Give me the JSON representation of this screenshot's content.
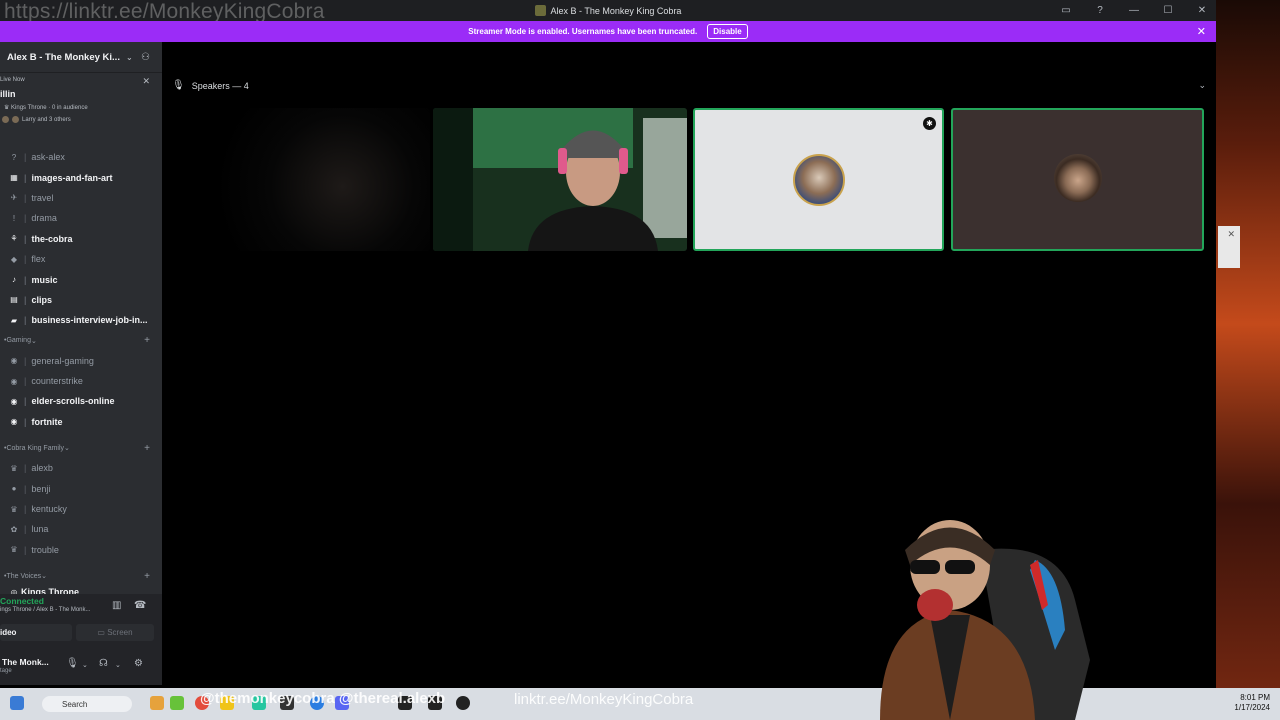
{
  "window": {
    "overlay_url": "https://linktr.ee/MonkeyKingCobra",
    "title": "Alex B - The Monkey King Cobra",
    "controls": [
      "▭",
      "?",
      "—",
      "☐",
      "✕"
    ]
  },
  "banner": {
    "message": "Streamer Mode is enabled. Usernames have been truncated.",
    "disable_label": "Disable",
    "close": "✕"
  },
  "sidebar": {
    "server_name": "Alex B - The Monkey Ki...",
    "live": {
      "label": "Live Now",
      "title": "illin",
      "stage": "Kings Throne · 0 in audience",
      "members": "Larry and 3 others"
    },
    "channels_a": [
      {
        "icon": "?",
        "name": "ask-alex",
        "bold": false
      },
      {
        "icon": "▦",
        "name": "images-and-fan-art",
        "bold": true
      },
      {
        "icon": "✈",
        "name": "travel",
        "bold": false
      },
      {
        "icon": "!",
        "name": "drama",
        "bold": false
      },
      {
        "icon": "⚘",
        "name": "the-cobra",
        "bold": true
      },
      {
        "icon": "◆",
        "name": "flex",
        "bold": false
      },
      {
        "icon": "♪",
        "name": "music",
        "bold": true
      },
      {
        "icon": "▤",
        "name": "clips",
        "bold": true
      },
      {
        "icon": "▰",
        "name": "business-interview-job-in...",
        "bold": true
      }
    ],
    "category_gaming": "Gaming",
    "channels_b": [
      {
        "icon": "◉",
        "name": "general-gaming",
        "bold": false
      },
      {
        "icon": "◉",
        "name": "counterstrike",
        "bold": false
      },
      {
        "icon": "◉",
        "name": "elder-scrolls-online",
        "bold": true
      },
      {
        "icon": "◉",
        "name": "fortnite",
        "bold": true
      }
    ],
    "category_family": "Cobra King Family",
    "channels_c": [
      {
        "icon": "♛",
        "name": "alexb",
        "bold": false
      },
      {
        "icon": "●",
        "name": "benji",
        "bold": false
      },
      {
        "icon": "♛",
        "name": "kentucky",
        "bold": false
      },
      {
        "icon": "✿",
        "name": "luna",
        "bold": false
      },
      {
        "icon": "♛",
        "name": "trouble",
        "bold": false
      }
    ],
    "category_voices": "The Voices",
    "voice_channel": "Kings Throne",
    "voice": {
      "connected": "Connected",
      "path": "ings Throne / Alex B - The Monk...",
      "video": "ideo",
      "screen": "Screen"
    },
    "user": {
      "name": "The Monk...",
      "sub": "tage"
    }
  },
  "main": {
    "speakers_label": "Speakers — 4"
  },
  "taskbar": {
    "search": "Search",
    "overlay_social": "@themonkeycobra @thereal.alexb",
    "overlay_link": "linktr.ee/MonkeyKingCobra",
    "time": "8:01 PM",
    "date": "1/17/2024"
  },
  "colors": {
    "banner": "#9b2cf7",
    "speaking_border": "#23a55a",
    "sidebar": "#2b2d31"
  }
}
